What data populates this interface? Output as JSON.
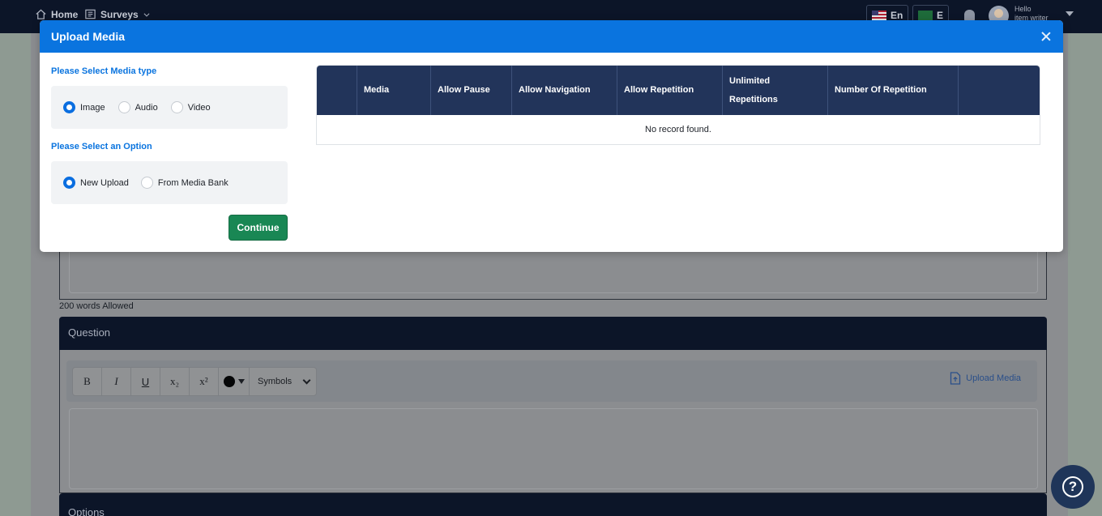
{
  "nav": {
    "home_label": "Home",
    "surveys_label": "Surveys",
    "lang_label": "En",
    "lang2_label": "E",
    "hello_label": "Hello",
    "user_label": "item writer"
  },
  "background": {
    "words_allowed": "200 words Allowed",
    "question_header": "Question",
    "options_header": "Options",
    "toolbar": {
      "bold": "B",
      "italic": "I",
      "underline": "U",
      "subscript": "x₂",
      "superscript": "x²",
      "symbols": "Symbols"
    },
    "upload_media_link": "Upload Media"
  },
  "modal": {
    "title": "Upload Media",
    "media_type_label": "Please Select Media type",
    "media_types": [
      {
        "label": "Image",
        "checked": true
      },
      {
        "label": "Audio",
        "checked": false
      },
      {
        "label": "Video",
        "checked": false
      }
    ],
    "option_label": "Please Select an Option",
    "options": [
      {
        "label": "New Upload",
        "checked": true
      },
      {
        "label": "From Media Bank",
        "checked": false
      }
    ],
    "continue_label": "Continue",
    "table": {
      "columns": [
        "",
        "Media",
        "Allow Pause",
        "Allow Navigation",
        "Allow Repetition",
        "Unlimited Repetitions",
        "Number Of Repetition",
        ""
      ],
      "empty_text": "No record found."
    }
  },
  "help_label": "?",
  "colors": {
    "primary": "#0a74df",
    "continue": "#198754",
    "table_header": "#22345a",
    "topbar": "#0c1528"
  }
}
